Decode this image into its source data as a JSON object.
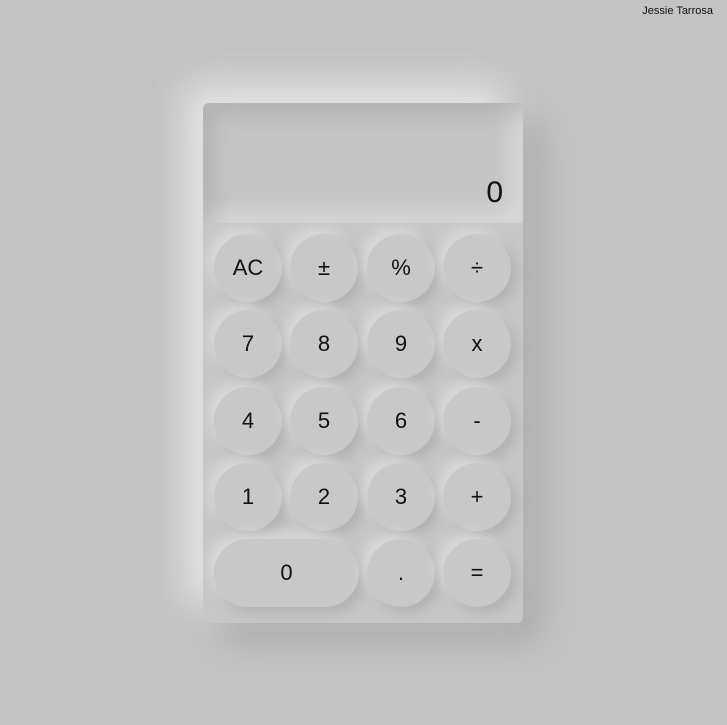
{
  "author": "Jessie Tarrosa",
  "display": {
    "value": "0"
  },
  "keys": {
    "ac": "AC",
    "plus_minus": "±",
    "percent": "%",
    "divide": "÷",
    "seven": "7",
    "eight": "8",
    "nine": "9",
    "multiply": "x",
    "four": "4",
    "five": "5",
    "six": "6",
    "subtract": "-",
    "one": "1",
    "two": "2",
    "three": "3",
    "add": "+",
    "zero": "0",
    "decimal": ".",
    "equals": "="
  },
  "colors": {
    "background": "#c3c3c3",
    "surface": "#c8c8c8",
    "text": "#111111"
  }
}
